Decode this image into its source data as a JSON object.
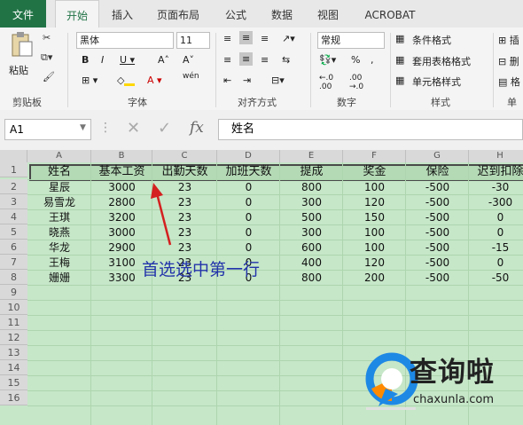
{
  "tabs": [
    "文件",
    "开始",
    "插入",
    "页面布局",
    "公式",
    "数据",
    "视图",
    "ACROBAT"
  ],
  "ribbon": {
    "clipboard_paste": "粘贴",
    "clipboard_label": "剪贴板",
    "font_name": "黑体",
    "font_size": "11",
    "font_label": "字体",
    "wen": "wén",
    "align_label": "对齐方式",
    "number_format": "常规",
    "number_label": "数字",
    "cond_format": "条件格式",
    "table_format": "套用表格格式",
    "cell_style": "单元格样式",
    "style_label": "样式",
    "cells_label": "单元"
  },
  "formula_bar": {
    "name_box": "A1",
    "fx": "fx",
    "content": "姓名"
  },
  "columns": [
    "A",
    "B",
    "C",
    "D",
    "E",
    "F",
    "G",
    "H"
  ],
  "rows": [
    "1",
    "2",
    "3",
    "4",
    "5",
    "6",
    "7",
    "8",
    "9",
    "10",
    "11",
    "12",
    "13",
    "14",
    "15",
    "16"
  ],
  "table": {
    "headers": [
      "姓名",
      "基本工资",
      "出勤天数",
      "加班天数",
      "提成",
      "奖金",
      "保险",
      "迟到扣除"
    ],
    "data": [
      [
        "星辰",
        "3000",
        "23",
        "0",
        "800",
        "100",
        "-500",
        "-30"
      ],
      [
        "易雪龙",
        "2800",
        "23",
        "0",
        "300",
        "120",
        "-500",
        "-300"
      ],
      [
        "王琪",
        "3200",
        "23",
        "0",
        "500",
        "150",
        "-500",
        "0"
      ],
      [
        "晓燕",
        "3000",
        "23",
        "0",
        "300",
        "100",
        "-500",
        "0"
      ],
      [
        "华龙",
        "2900",
        "23",
        "0",
        "600",
        "100",
        "-500",
        "-15"
      ],
      [
        "王梅",
        "3100",
        "23",
        "0",
        "400",
        "120",
        "-500",
        "0"
      ],
      [
        "姗姗",
        "3300",
        "23",
        "0",
        "800",
        "200",
        "-500",
        "-50"
      ]
    ]
  },
  "annotation": "首选选中第一行",
  "watermark": {
    "text": "查询啦",
    "url": "chaxunla.com"
  },
  "colors": {
    "excel_green": "#217346",
    "selection": "#b4d9b5",
    "annotation": "#2233aa",
    "arrow": "#d42020",
    "logo_blue": "#1e88e5",
    "logo_orange": "#ff8a00"
  }
}
